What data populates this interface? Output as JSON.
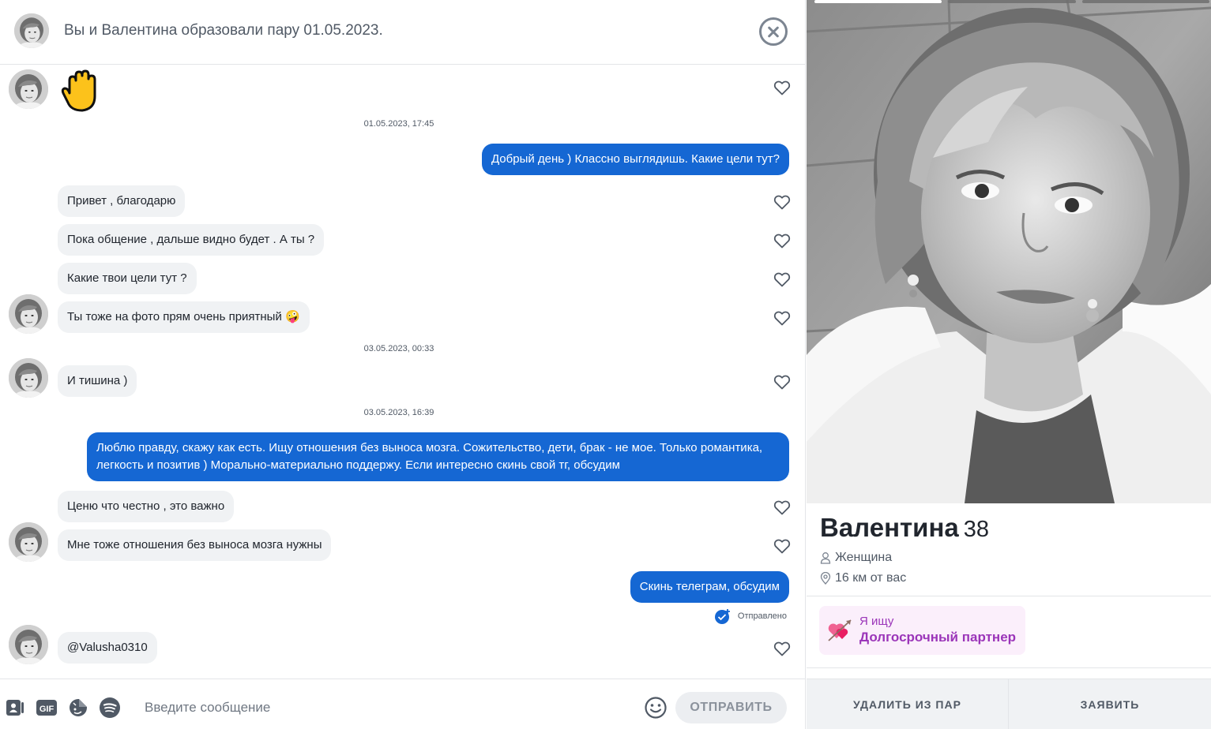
{
  "header": {
    "title": "Вы и Валентина образовали пару 01.05.2023."
  },
  "messages": [
    {
      "type": "in",
      "text": "Привет , благодарю"
    },
    {
      "type": "in",
      "text": "Пока общение , дальше видно будет . А ты ?"
    },
    {
      "type": "in",
      "text": "Какие твои цели тут ?"
    },
    {
      "type": "in",
      "text": "Ты тоже на фото прям очень приятный 🤪"
    },
    {
      "type": "in",
      "text": "И тишина )"
    },
    {
      "type": "in",
      "text": "Ценю что честно , это важно"
    },
    {
      "type": "in",
      "text": "Мне тоже отношения без выноса мозга нужны"
    },
    {
      "type": "in",
      "text": "@Valusha0310"
    },
    {
      "type": "out",
      "text": "Добрый день ) Классно выглядишь. Какие цели тут?"
    },
    {
      "type": "out",
      "text": "Люблю правду, скажу как есть. Ищу отношения без выноса мозга. Сожительство, дети, брак - не мое. Только романтика, легкость и позитив ) Морально-материально поддержу. Если интересно скинь свой тг, обсудим"
    },
    {
      "type": "out",
      "text": "Скинь телеграм, обсудим"
    }
  ],
  "timestamps": [
    "01.05.2023, 17:45",
    "03.05.2023, 00:33",
    "03.05.2023, 16:39"
  ],
  "status": {
    "sent_label": "Отправлено"
  },
  "composer": {
    "placeholder": "Введите сообщение",
    "send_label": "ОТПРАВИТЬ",
    "gif_label": "GIF"
  },
  "profile": {
    "name": "Валентина",
    "age": "38",
    "gender": "Женщина",
    "distance": "16 км от вас",
    "looking_label": "Я ищу",
    "looking_value": "Долгосрочный партнер",
    "photo_count": 3,
    "active_photo": 1,
    "remove_label": "УДАЛИТЬ ИЗ ПАР",
    "report_label": "ЗАЯВИТЬ"
  },
  "colors": {
    "accent": "#1567d3",
    "incoming_bubble": "#f0f2f4",
    "looking_bg": "#fbeffb",
    "looking_text": "#9b35b9"
  },
  "icons": [
    "close-icon",
    "heart-icon",
    "raised-hand-emoji",
    "sent-check-icon",
    "contact-card-icon",
    "gif-icon",
    "sticker-icon",
    "spotify-icon",
    "smiley-icon",
    "person-icon",
    "location-pin-icon",
    "heart-arrow-icon"
  ]
}
